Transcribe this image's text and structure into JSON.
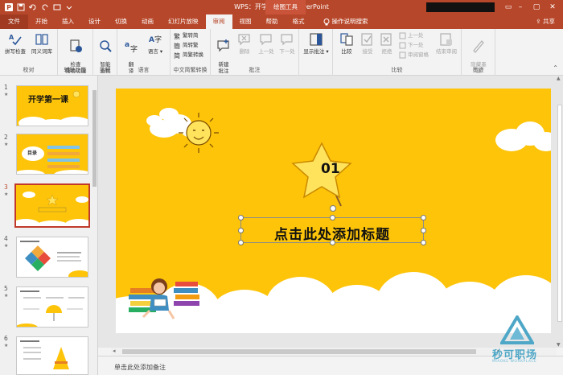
{
  "window": {
    "title": "WPS：开学第一课 - PowerPoint",
    "context_tab": "绘图工具",
    "controls": {
      "minimize": "–",
      "restore": "▢",
      "close": "✕"
    }
  },
  "tabs": [
    {
      "label": "文件",
      "kind": "file"
    },
    {
      "label": "开始"
    },
    {
      "label": "插入"
    },
    {
      "label": "设计"
    },
    {
      "label": "切换"
    },
    {
      "label": "动画"
    },
    {
      "label": "幻灯片放映"
    },
    {
      "label": "审阅",
      "active": true
    },
    {
      "label": "视图"
    },
    {
      "label": "帮助"
    },
    {
      "label": "格式"
    }
  ],
  "tell_me": "操作说明搜索",
  "share": "共享",
  "ribbon": {
    "groups": {
      "proofing": "校对",
      "accessibility": "辅助功能",
      "insights": "见解",
      "language": "语言",
      "chinese_conv": "中文简繁转换",
      "comments": "批注",
      "compare": "比较",
      "ink": "墨迹"
    },
    "buttons": {
      "spell": "拼写检查",
      "thesaurus": "同义词库",
      "check_access": "检查\n辅助功能",
      "smart_lookup": "智能\n查找",
      "translate": "翻\n译",
      "language": "语言",
      "to_trad": "繁转简",
      "to_simp": "简转繁",
      "conv": "简繁转换",
      "new_comment": "新建\n批注",
      "delete": "删除",
      "prev": "上一处",
      "next": "下一处",
      "show_comments": "显示批注",
      "compare": "比较",
      "accept": "接受",
      "reject": "拒绝",
      "prev_change": "上一处",
      "next_change": "下一处",
      "review_pane": "审阅窗格",
      "end_review": "结束审阅",
      "hide_ink": "隐藏墨\n迹"
    }
  },
  "thumbnails": [
    {
      "number": "1",
      "star": "★",
      "title": "开学第一课"
    },
    {
      "number": "2",
      "star": "★",
      "title": "目录"
    },
    {
      "number": "3",
      "star": "★",
      "selected": true
    },
    {
      "number": "4",
      "star": "★"
    },
    {
      "number": "5",
      "star": "★"
    },
    {
      "number": "6",
      "star": "★"
    }
  ],
  "slide": {
    "number_badge": "01",
    "title_placeholder": "点击此处添加标题"
  },
  "notes_placeholder": "单击此处添加备注",
  "watermark": {
    "text": "秒可职场",
    "sub": "MIAOKE WORKPLACE"
  },
  "colors": {
    "accent": "#b7472a",
    "slide_bg": "#fdc40a",
    "selected_thumb": "#c0392b"
  }
}
